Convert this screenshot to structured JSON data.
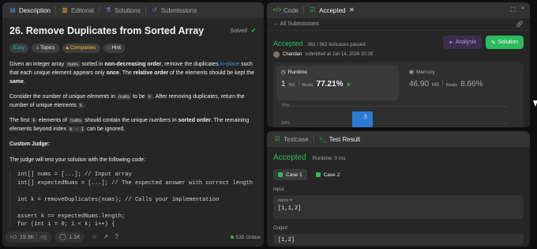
{
  "left_tabs": [
    {
      "label": "Description",
      "icon": "description-icon"
    },
    {
      "label": "Editorial",
      "icon": "editorial-icon"
    },
    {
      "label": "Solutions",
      "icon": "solutions-icon"
    },
    {
      "label": "Submissions",
      "icon": "submissions-icon"
    }
  ],
  "problem": {
    "title": "26. Remove Duplicates from Sorted Array",
    "status": "Solved",
    "tags": [
      "Easy",
      "Topics",
      "Companies",
      "Hint"
    ],
    "p1_a": "Given an integer array ",
    "p1_code": "nums",
    "p1_b": " sorted in ",
    "p1_bold1": "non-decreasing order",
    "p1_c": ", remove the duplicates ",
    "p1_link": "in-place",
    "p1_d": " such that each unique element appears only ",
    "p1_bold2": "once",
    "p1_e": ". The ",
    "p1_bold3": "relative order",
    "p1_f": " of the elements should be kept the ",
    "p1_bold4": "same",
    "p1_g": ".",
    "p2_a": "Consider the number of ",
    "p2_i": "unique elements",
    "p2_b": " in ",
    "p2_code1": "nums",
    "p2_c": " to be ",
    "p2_code2": "k",
    "p2_d": ". After removing duplicates, return the number of unique elements ",
    "p2_code3": "k",
    "p2_e": ".",
    "p3_a": "The first ",
    "p3_code1": "k",
    "p3_b": " elements of ",
    "p3_code2": "nums",
    "p3_c": " should contain the unique numbers in ",
    "p3_bold": "sorted order",
    "p3_d": ". The remaining elements beyond index ",
    "p3_code3": "k - 1",
    "p3_e": " can be ignored.",
    "judge_heading": "Custom Judge:",
    "judge_text": "The judge will test your solution with the following code:",
    "code": "int[] nums = [...]; // Input array\nint[] expectedNums = [...]; // The expected answer with correct length\n\nint k = removeDuplicates(nums); // Calls your implementation\n\nassert k == expectedNums.length;\nfor (int i = 0; i < k; i++) {\n    assert nums[i] == expectedNums[i];\n}"
  },
  "bottom": {
    "likes": "19.3K",
    "comments": "1.1K",
    "online": "535 Online"
  },
  "right_top": {
    "tabs": [
      "Code",
      "Accepted"
    ],
    "back": "All Submissions",
    "status": "Accepted",
    "passed": "362 / 362 testcases passed",
    "user": "Chandan",
    "submitted": "submitted at Jun 14, 2026 20:28",
    "analysis_btn": "Analysis",
    "solution_btn": "Solution",
    "runtime_label": "Runtime",
    "runtime_value": "1",
    "runtime_unit": "ms",
    "beats_label": "Beats",
    "runtime_beats": "77.21%",
    "memory_label": "Memory",
    "memory_value": "46.90",
    "memory_unit": "MB",
    "memory_beats": "8.66%",
    "axis_75": "75%",
    "axis_50": "50%"
  },
  "right_bottom": {
    "tabs": [
      "Testcase",
      "Test Result"
    ],
    "status": "Accepted",
    "runtime": "Runtime: 0 ms",
    "cases": [
      "Case 1",
      "Case 2"
    ],
    "input_label": "Input",
    "var_name": "nums =",
    "var_value": "[1,1,2]",
    "output_label": "Output",
    "output_value": "[1,2]"
  },
  "colors": {
    "accent_green": "#2cbb5d",
    "accent_blue": "#2d7ad6",
    "easy": "#1cbaba",
    "companies": "#ffc01e"
  }
}
